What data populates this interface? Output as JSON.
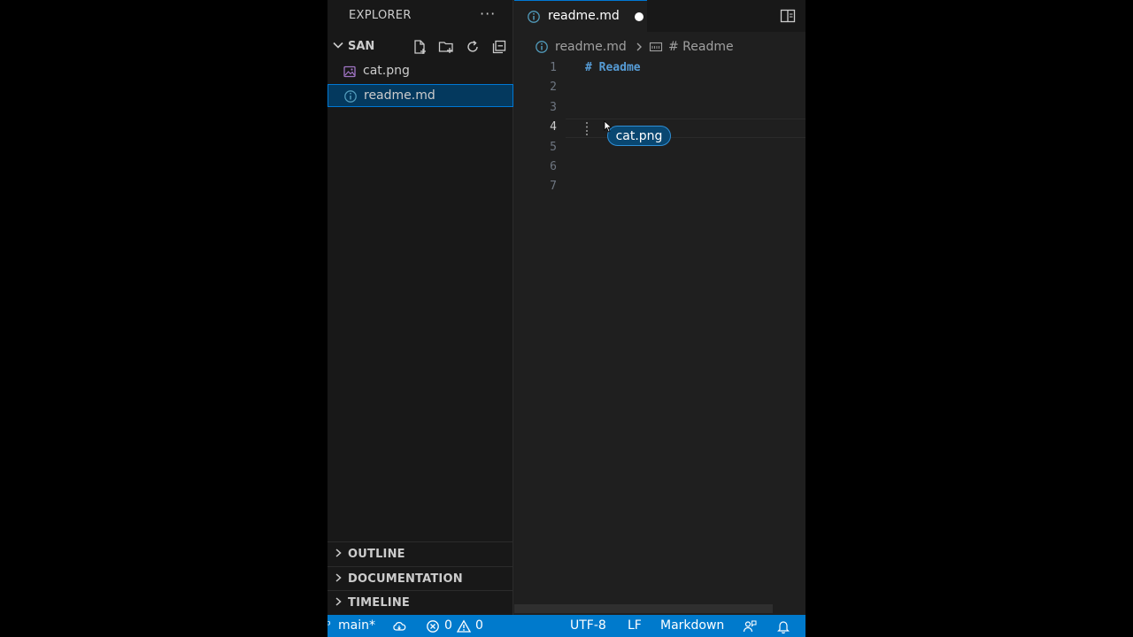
{
  "sidebar": {
    "title": "EXPLORER",
    "more": "···",
    "folder": "SAN",
    "files": [
      {
        "label": "cat.png",
        "icon": "image-file-icon"
      },
      {
        "label": "readme.md",
        "icon": "info-icon",
        "selected": true
      }
    ],
    "panels": [
      "OUTLINE",
      "DOCUMENTATION",
      "TIMELINE"
    ]
  },
  "editor": {
    "tab": {
      "label": "readme.md",
      "dirty": true
    },
    "breadcrumb": {
      "file": "readme.md",
      "section": "# Readme"
    },
    "lines": [
      "1",
      "2",
      "3",
      "4",
      "5",
      "6",
      "7"
    ],
    "active_line": 4,
    "code": {
      "line1": "# Readme"
    },
    "drop_chip": "cat.png"
  },
  "statusbar": {
    "branch": "main*",
    "errors": "0",
    "warnings": "0",
    "encoding": "UTF-8",
    "eol": "LF",
    "language": "Markdown"
  },
  "colors": {
    "accent": "#007acc",
    "selection": "#04395e",
    "heading": "#569cd6"
  }
}
